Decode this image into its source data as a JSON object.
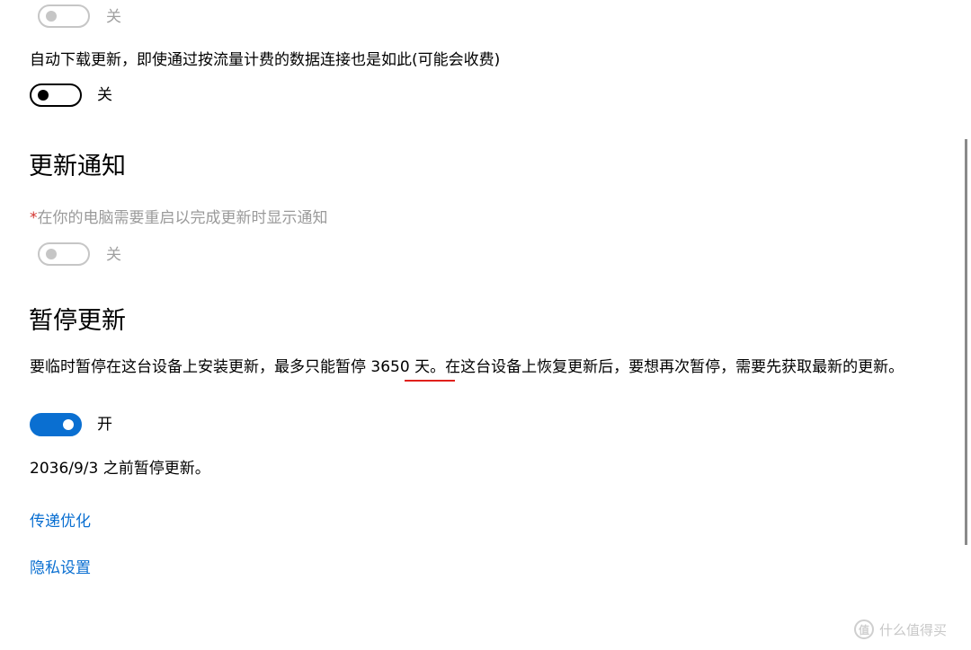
{
  "sections": {
    "top_toggle": {
      "state": "关",
      "on": false,
      "disabled": true
    },
    "metered_download": {
      "label": "自动下载更新，即使通过按流量计费的数据连接也是如此(可能会收费)",
      "toggle_state": "关",
      "on": false
    },
    "notifications": {
      "heading": "更新通知",
      "asterisk": "*",
      "label": "在你的电脑需要重启以完成更新时显示通知",
      "toggle_state": "关",
      "on": false,
      "disabled": true
    },
    "pause": {
      "heading": "暂停更新",
      "text_before": "要临时暂停在这台设备上安装更新，最多只能暂停 ",
      "highlight": "3650 天",
      "text_after": "。在这台设备上恢复更新后，要想再次暂停，需要先获取最新的更新。",
      "toggle_state": "开",
      "on": true,
      "until_text": "2036/9/3 之前暂停更新。"
    }
  },
  "links": {
    "delivery_optimization": "传递优化",
    "privacy_settings": "隐私设置"
  },
  "watermark": {
    "icon": "值",
    "text": "什么值得买"
  },
  "colors": {
    "accent": "#0a6fd1",
    "annotation_red": "#e0201b",
    "disabled": "#c6c6c6"
  }
}
